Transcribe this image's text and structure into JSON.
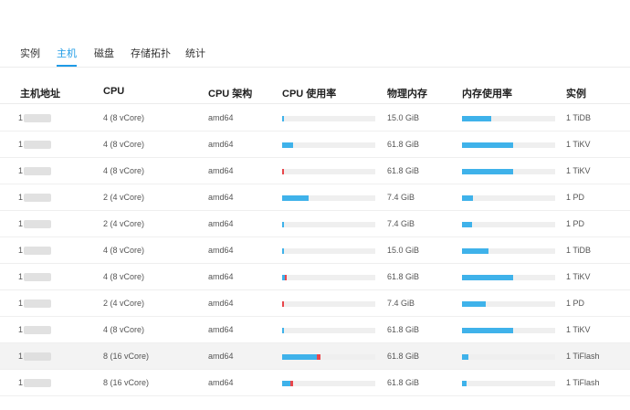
{
  "tabs": [
    {
      "label": "实例",
      "active": false
    },
    {
      "label": "主机",
      "active": true
    },
    {
      "label": "磁盘",
      "active": false
    },
    {
      "label": "存储拓扑",
      "active": false
    },
    {
      "label": "统计",
      "active": false
    }
  ],
  "columns": {
    "host": "主机地址",
    "cpu": "CPU",
    "arch": "CPU 架构",
    "cpu_usage": "CPU 使用率",
    "memory": "物理内存",
    "mem_usage": "内存使用率",
    "instance": "实例"
  },
  "colors": {
    "accent": "#1e9be6",
    "bar_fill": "#3fb2ea",
    "bar_critical": "#e8474c",
    "bar_track": "#efefef"
  },
  "rows": [
    {
      "host": "1",
      "cpu": "4 (8 vCore)",
      "arch": "amd64",
      "cpu_usage": 0.02,
      "cpu_critical": 0,
      "memory": "15.0 GiB",
      "mem_usage": 0.31,
      "instance": "1 TiDB",
      "highlight": false
    },
    {
      "host": "1",
      "cpu": "4 (8 vCore)",
      "arch": "amd64",
      "cpu_usage": 0.12,
      "cpu_critical": 0,
      "memory": "61.8 GiB",
      "mem_usage": 0.55,
      "instance": "1 TiKV",
      "highlight": false
    },
    {
      "host": "1",
      "cpu": "4 (8 vCore)",
      "arch": "amd64",
      "cpu_usage": 0.0,
      "cpu_critical": 0.02,
      "memory": "61.8 GiB",
      "mem_usage": 0.55,
      "instance": "1 TiKV",
      "highlight": false
    },
    {
      "host": "1",
      "cpu": "2 (4 vCore)",
      "arch": "amd64",
      "cpu_usage": 0.28,
      "cpu_critical": 0,
      "memory": "7.4 GiB",
      "mem_usage": 0.12,
      "instance": "1 PD",
      "highlight": false
    },
    {
      "host": "1",
      "cpu": "2 (4 vCore)",
      "arch": "amd64",
      "cpu_usage": 0.01,
      "cpu_critical": 0,
      "memory": "7.4 GiB",
      "mem_usage": 0.11,
      "instance": "1 PD",
      "highlight": false
    },
    {
      "host": "1",
      "cpu": "4 (8 vCore)",
      "arch": "amd64",
      "cpu_usage": 0.02,
      "cpu_critical": 0,
      "memory": "15.0 GiB",
      "mem_usage": 0.28,
      "instance": "1 TiDB",
      "highlight": false
    },
    {
      "host": "1",
      "cpu": "4 (8 vCore)",
      "arch": "amd64",
      "cpu_usage": 0.03,
      "cpu_critical": 0.01,
      "memory": "61.8 GiB",
      "mem_usage": 0.55,
      "instance": "1 TiKV",
      "highlight": false
    },
    {
      "host": "1",
      "cpu": "2 (4 vCore)",
      "arch": "amd64",
      "cpu_usage": 0.0,
      "cpu_critical": 0.02,
      "memory": "7.4 GiB",
      "mem_usage": 0.25,
      "instance": "1 PD",
      "highlight": false
    },
    {
      "host": "1",
      "cpu": "4 (8 vCore)",
      "arch": "amd64",
      "cpu_usage": 0.02,
      "cpu_critical": 0,
      "memory": "61.8 GiB",
      "mem_usage": 0.55,
      "instance": "1 TiKV",
      "highlight": false
    },
    {
      "host": "1",
      "cpu": "8 (16 vCore)",
      "arch": "amd64",
      "cpu_usage": 0.37,
      "cpu_critical": 0.04,
      "memory": "61.8 GiB",
      "mem_usage": 0.07,
      "instance": "1 TiFlash",
      "highlight": true
    },
    {
      "host": "1",
      "cpu": "8 (16 vCore)",
      "arch": "amd64",
      "cpu_usage": 0.09,
      "cpu_critical": 0.03,
      "memory": "61.8 GiB",
      "mem_usage": 0.05,
      "instance": "1 TiFlash",
      "highlight": false
    }
  ]
}
